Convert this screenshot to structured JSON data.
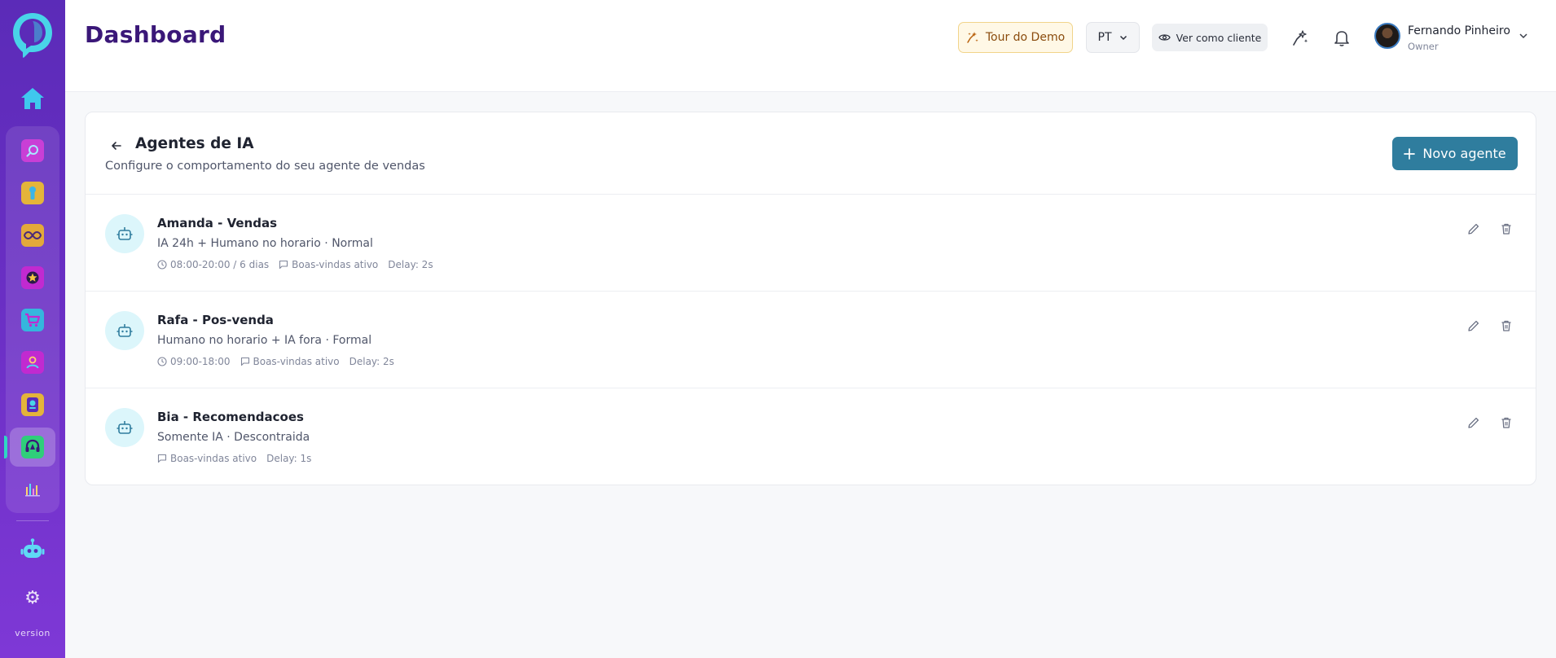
{
  "sidebar": {
    "apps": [
      {
        "name": "search-app",
        "color": "#c93fd6"
      },
      {
        "name": "keyhole-app",
        "color": "#e4b43a"
      },
      {
        "name": "infinity-app",
        "color": "#e3a93a"
      },
      {
        "name": "star-app",
        "color": "#c12ad0"
      },
      {
        "name": "cart-app",
        "color": "#35b6dd"
      },
      {
        "name": "contacts-app",
        "color": "#c12ad0"
      },
      {
        "name": "badge-app",
        "color": "#e4b43a"
      },
      {
        "name": "agent-app",
        "color": "#2fce7a"
      },
      {
        "name": "analytics-app",
        "color": "#6d3fd0"
      }
    ],
    "version_label": "version"
  },
  "header": {
    "title": "Dashboard",
    "tour_label": "Tour do Demo",
    "lang_label": "PT",
    "view_as_label": "Ver como cliente",
    "user": {
      "name": "Fernando Pinheiro",
      "role": "Owner"
    }
  },
  "card": {
    "title": "Agentes de IA",
    "subtitle": "Configure o comportamento do seu agente de vendas",
    "new_button_label": "Novo agente"
  },
  "agents": [
    {
      "name": "Amanda - Vendas",
      "description": "IA 24h + Humano no horario · Normal",
      "hours": "08:00-20:00 / 6 dias",
      "welcome": "Boas-vindas ativo",
      "delay": "Delay: 2s"
    },
    {
      "name": "Rafa - Pos-venda",
      "description": "Humano no horario + IA fora · Formal",
      "hours": "09:00-18:00",
      "welcome": "Boas-vindas ativo",
      "delay": "Delay: 2s"
    },
    {
      "name": "Bia - Recomendacoes",
      "description": "Somente IA · Descontraida",
      "welcome": "Boas-vindas ativo",
      "delay": "Delay: 1s"
    }
  ],
  "colors": {
    "brand_purple": "#5b2bb8",
    "accent_teal": "#2f7d9e",
    "title_purple": "#3a1778"
  }
}
